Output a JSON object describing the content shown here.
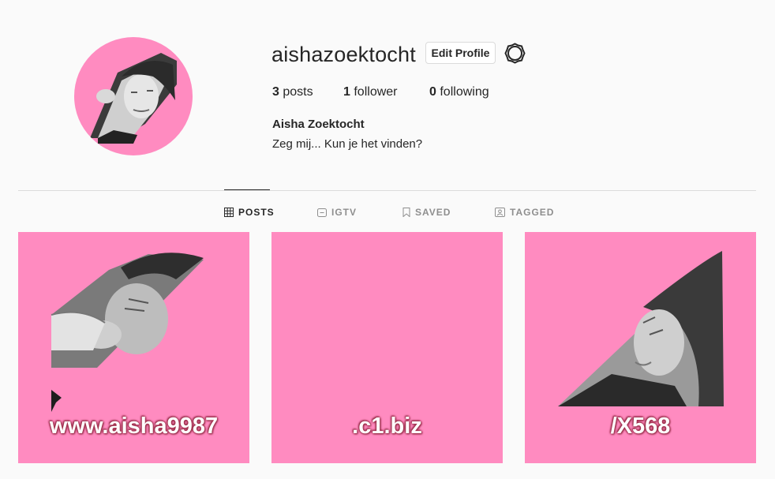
{
  "profile": {
    "username": "aishazoektocht",
    "edit_button": "Edit Profile",
    "full_name": "Aisha Zoektocht",
    "bio": "Zeg mij... Kun je het vinden?",
    "accent_color": "#ff8bc0"
  },
  "stats": {
    "posts_count": "3",
    "posts_label": "posts",
    "followers_count": "1",
    "followers_label": "follower",
    "following_count": "0",
    "following_label": "following"
  },
  "tabs": [
    {
      "label": "POSTS",
      "icon": "grid-icon",
      "active": true
    },
    {
      "label": "IGTV",
      "icon": "tv-icon",
      "active": false
    },
    {
      "label": "SAVED",
      "icon": "bookmark-icon",
      "active": false
    },
    {
      "label": "TAGGED",
      "icon": "tag-person-icon",
      "active": false
    }
  ],
  "posts": [
    {
      "caption": "www.aisha9987"
    },
    {
      "caption": ".c1.biz"
    },
    {
      "caption": "/X568"
    }
  ]
}
